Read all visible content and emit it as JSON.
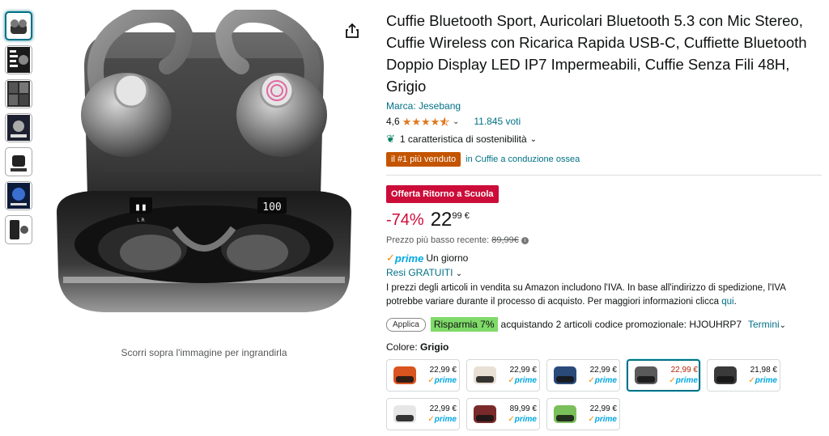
{
  "thumbnails": {
    "count": 7,
    "active_index": 0
  },
  "gallery": {
    "zoom_hint": "Scorri sopra l'immagine per ingrandirla",
    "case_display_left": "L R",
    "case_display_right": "100"
  },
  "product": {
    "title": "Cuffie Bluetooth Sport, Auricolari Bluetooth 5.3 con Mic Stereo, Cuffie Wireless con Ricarica Rapida USB-C, Cuffiette Bluetooth Doppio Display LED IP7 Impermeabili, Cuffie Senza Fili 48H, Grigio",
    "brand": "Marca: Jesebang",
    "rating": "4,6",
    "rating_stars": 4.6,
    "votes": "11.845 voti",
    "sustainability": "1 caratteristica di sostenibilità",
    "bestseller_badge": "il #1 più venduto",
    "bestseller_category": "in Cuffie a conduzione ossea"
  },
  "pricing": {
    "deal_badge": "Offerta Ritorno a Scuola",
    "discount": "-74%",
    "price_int": "22",
    "price_dec": "99 €",
    "lowest_label": "Prezzo più basso recente:",
    "lowest_value": "89,99€",
    "prime_text": "prime",
    "prime_delivery": "Un giorno",
    "returns": "Resi GRATUITI",
    "vat_text": "I prezzi degli articoli in vendita su Amazon includono l'IVA. In base all'indirizzo di spedizione, l'IVA potrebbe variare durante il processo di acquisto. Per maggiori informazioni clicca",
    "vat_link": "qui",
    "vat_end": "."
  },
  "promo": {
    "apply_label": "Applica",
    "save_label": "Risparmia 7%",
    "text": "acquistando 2 articoli codice promozionale: HJOUHRP7",
    "terms": "Termini"
  },
  "color": {
    "label": "Colore:",
    "selected": "Grigio",
    "options": [
      {
        "price": "22,99 €",
        "prime": "prime",
        "color": "#d9541e"
      },
      {
        "price": "22,99 €",
        "prime": "prime",
        "color": "#e8e0d4"
      },
      {
        "price": "22,99 €",
        "prime": "prime",
        "color": "#2a4a7a"
      },
      {
        "price": "22,99 €",
        "prime": "prime",
        "color": "#5a5a5a"
      },
      {
        "price": "21,98 €",
        "prime": "prime",
        "color": "#3a3a3a"
      },
      {
        "price": "22,99 €",
        "prime": "prime",
        "color": "#e6e6e6"
      },
      {
        "price": "89,99 €",
        "prime": "prime",
        "color": "#7a2a2a"
      },
      {
        "price": "22,99 €",
        "prime": "prime",
        "color": "#7bbf5a"
      }
    ],
    "selected_index": 3
  }
}
